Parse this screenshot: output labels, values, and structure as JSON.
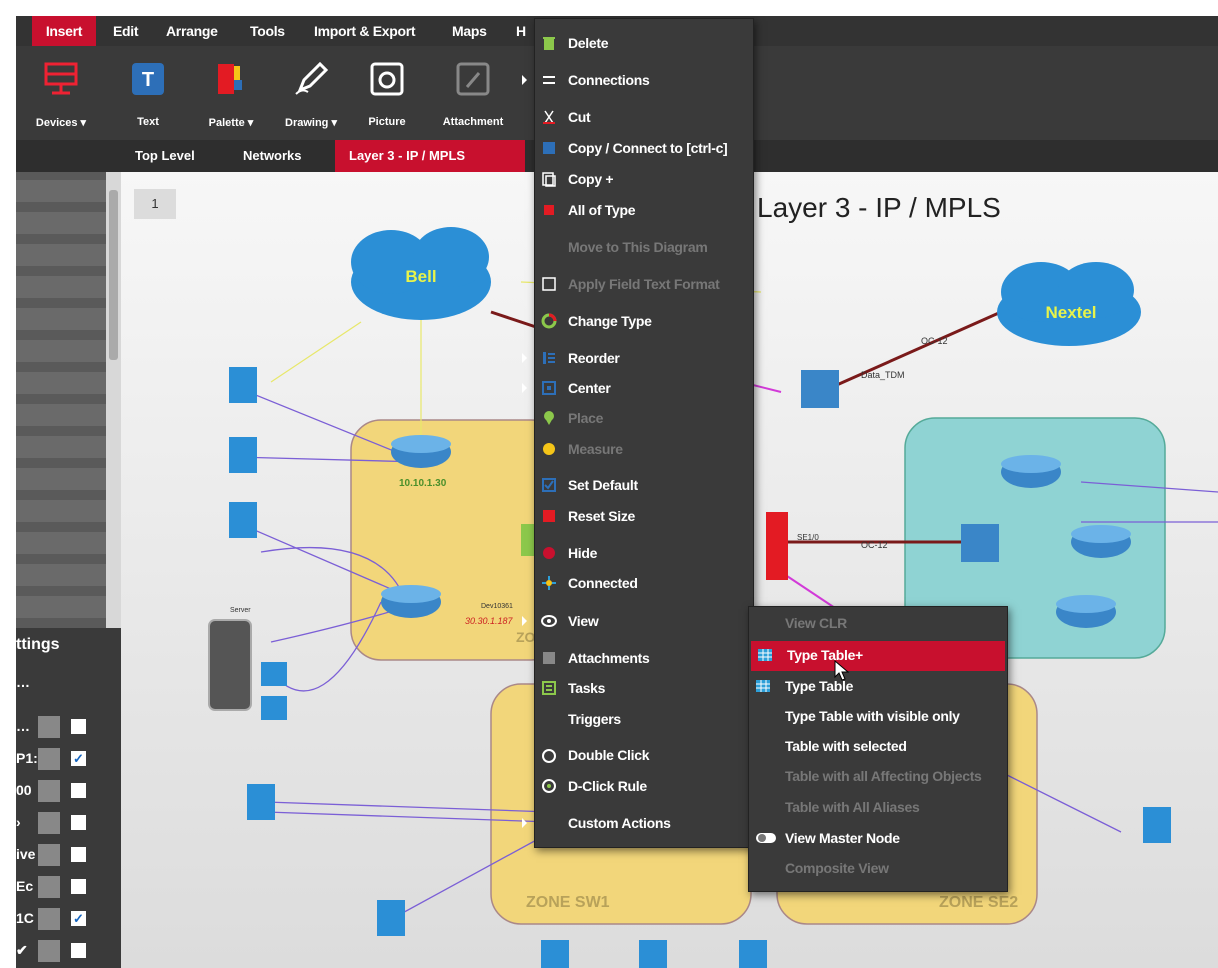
{
  "menubar": {
    "items": [
      "Insert",
      "Edit",
      "Arrange",
      "Tools",
      "Import & Export",
      "Maps",
      "H"
    ]
  },
  "ribbon": {
    "buttons": [
      "Devices ▾",
      "Text",
      "Palette ▾",
      "Drawing ▾",
      "Picture",
      "Attachment"
    ]
  },
  "breadcrumb": [
    "Top Level",
    "Networks",
    "Layer 3 - IP / MPLS"
  ],
  "canvas": {
    "page_number": "1",
    "title": "Layer 3 - IP / MPLS",
    "clouds": [
      "Bell",
      "Nextel"
    ],
    "zones": [
      "ZONE",
      "ZONE SW1",
      "ZONE SE2"
    ],
    "labels": {
      "ip_1": "10.10.1.30",
      "ip_2": "30.30.1.187",
      "server": "Server",
      "dev_1": "Dev10361",
      "link_1": "Data_TDM",
      "link_2": "OC-12",
      "link_3": "OC-12",
      "port": "SE1/0"
    }
  },
  "settings_panel": {
    "title": "ttings",
    "rows": [
      {
        "text": "…",
        "checked": null
      },
      {
        "text": "…",
        "checked": false
      },
      {
        "text": "P1:",
        "checked": true
      },
      {
        "text": "00",
        "checked": false
      },
      {
        "text": "›",
        "checked": false
      },
      {
        "text": "ive",
        "checked": false
      },
      {
        "text": "Ec",
        "checked": false
      },
      {
        "text": "1C",
        "checked": true
      },
      {
        "text": "✔",
        "checked": false
      }
    ]
  },
  "context_menu": {
    "items": [
      {
        "label": "Delete",
        "icon": "trash-icon",
        "disabled": false,
        "submenu": false
      },
      {
        "label": "Connections",
        "icon": "connections-icon",
        "disabled": false,
        "submenu": true
      },
      {
        "label": "Cut",
        "icon": "scissors-icon",
        "disabled": false,
        "submenu": false
      },
      {
        "label": "Copy / Connect to [ctrl-c]",
        "icon": "copy-connect-icon",
        "disabled": false,
        "submenu": false
      },
      {
        "label": "Copy +",
        "icon": "copy-plus-icon",
        "disabled": false,
        "submenu": false
      },
      {
        "label": "All of Type",
        "icon": "all-of-type-icon",
        "disabled": false,
        "submenu": false
      },
      {
        "label": "Move to This Diagram",
        "icon": "",
        "disabled": true,
        "submenu": false
      },
      {
        "label": "Apply Field Text Format",
        "icon": "format-icon",
        "disabled": true,
        "submenu": false
      },
      {
        "label": "Change Type",
        "icon": "change-type-icon",
        "disabled": false,
        "submenu": false
      },
      {
        "label": "Reorder",
        "icon": "reorder-icon",
        "disabled": false,
        "submenu": true
      },
      {
        "label": "Center",
        "icon": "center-icon",
        "disabled": false,
        "submenu": true
      },
      {
        "label": "Place",
        "icon": "place-pin-icon",
        "disabled": true,
        "submenu": false
      },
      {
        "label": "Measure",
        "icon": "measure-icon",
        "disabled": true,
        "submenu": false
      },
      {
        "label": "Set Default",
        "icon": "set-default-icon",
        "disabled": false,
        "submenu": false
      },
      {
        "label": "Reset Size",
        "icon": "reset-size-icon",
        "disabled": false,
        "submenu": false
      },
      {
        "label": "Hide",
        "icon": "hide-icon",
        "disabled": false,
        "submenu": false
      },
      {
        "label": "Connected",
        "icon": "connected-icon",
        "disabled": false,
        "submenu": false
      },
      {
        "label": "View",
        "icon": "eye-icon",
        "disabled": false,
        "submenu": true,
        "highlighted": true
      },
      {
        "label": "Attachments",
        "icon": "attachments-icon",
        "disabled": false,
        "submenu": false
      },
      {
        "label": "Tasks",
        "icon": "tasks-icon",
        "disabled": false,
        "submenu": false
      },
      {
        "label": "Triggers",
        "icon": "",
        "disabled": false,
        "submenu": false
      },
      {
        "label": "Double Click",
        "icon": "double-click-icon",
        "disabled": false,
        "submenu": false
      },
      {
        "label": "D-Click Rule",
        "icon": "d-click-rule-icon",
        "disabled": false,
        "submenu": false
      },
      {
        "label": "Custom Actions",
        "icon": "",
        "disabled": false,
        "submenu": true
      }
    ]
  },
  "view_submenu": {
    "items": [
      {
        "label": "View CLR",
        "icon": "",
        "disabled": true
      },
      {
        "label": "Type Table+",
        "icon": "table-icon",
        "disabled": false,
        "highlighted": true
      },
      {
        "label": "Type Table",
        "icon": "table-icon",
        "disabled": false
      },
      {
        "label": "Type Table with visible only",
        "icon": "",
        "disabled": false
      },
      {
        "label": "Table with selected",
        "icon": "",
        "disabled": false
      },
      {
        "label": "Table with all Affecting Objects",
        "icon": "",
        "disabled": true
      },
      {
        "label": "Table with All Aliases",
        "icon": "",
        "disabled": true
      },
      {
        "label": "View Master Node",
        "icon": "toggle-icon",
        "disabled": false
      },
      {
        "label": "Composite View",
        "icon": "",
        "disabled": true
      }
    ]
  },
  "colors": {
    "accent": "#c8102e",
    "menu_bg": "#3a3a3a",
    "zone_yellow": "#f2d67a",
    "zone_teal": "#8fd3d3",
    "cloud_blue": "#2b8fd6"
  }
}
